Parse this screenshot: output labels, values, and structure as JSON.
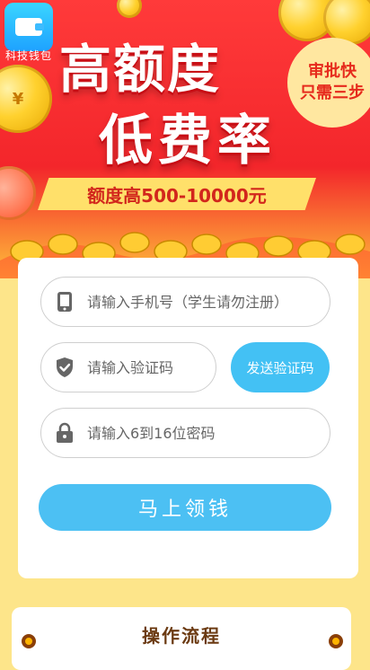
{
  "app": {
    "name": "科技钱包"
  },
  "hero": {
    "headline_1": "高额度",
    "headline_2": "低费率",
    "badge_line_1": "审批快",
    "badge_line_2": "只需三步",
    "ribbon": "额度高500-10000元"
  },
  "form": {
    "phone_placeholder": "请输入手机号（学生请勿注册）",
    "code_placeholder": "请输入验证码",
    "send_code_label": "发送验证码",
    "password_placeholder": "请输入6到16位密码",
    "submit_label": "马上领钱"
  },
  "process": {
    "title": "操作流程"
  },
  "colors": {
    "accent": "#4cc0f3",
    "hero_red": "#f3262b",
    "background": "#fde58a"
  }
}
